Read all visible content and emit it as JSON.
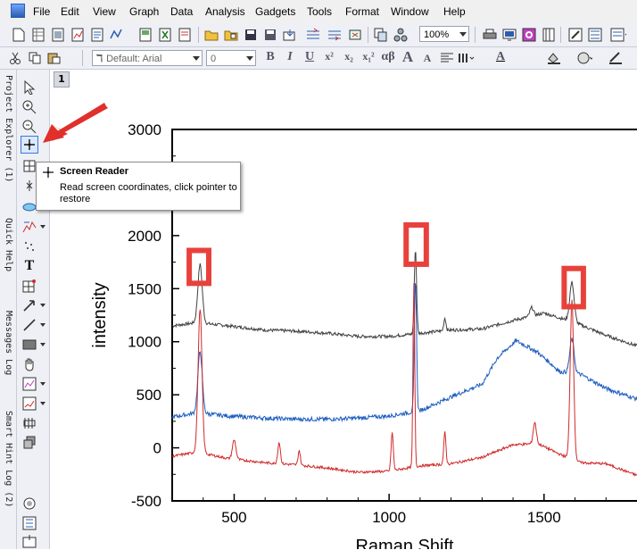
{
  "menu": [
    "File",
    "Edit",
    "View",
    "Graph",
    "Data",
    "Analysis",
    "Gadgets",
    "Tools",
    "Format",
    "Window",
    "Help"
  ],
  "toolbar": {
    "zoom_value": "100%",
    "font_name": "Default: Arial",
    "font_size": "0",
    "bold": "B",
    "italic": "I",
    "underline": "U",
    "superscript": "x²",
    "subscript": "x₂",
    "supsub": "x₁²",
    "greek": "αβ",
    "grow_font": "A",
    "shrink_font": "A",
    "font_color": "A"
  },
  "left_panels": [
    "Project Explorer (1)",
    "Quick Help",
    "Messages Log",
    "Smart Hint Log (2)"
  ],
  "graph": {
    "layer_label": "1"
  },
  "tooltip": {
    "title": "Screen Reader",
    "body": "Read screen coordinates, click pointer to restore"
  },
  "colors": {
    "black_series": "#404040",
    "blue_series": "#1f5fbf",
    "red_series": "#d02b2b",
    "highlight": "#e8413c"
  },
  "chart_data": {
    "type": "line",
    "xlabel": "Raman Shift",
    "ylabel": "intensity",
    "xlim": [
      300,
      1800
    ],
    "ylim": [
      -500,
      3000
    ],
    "x_ticks": [
      500,
      1000,
      1500
    ],
    "y_ticks": [
      -500,
      0,
      500,
      1000,
      1500,
      2000,
      2500,
      3000
    ],
    "series": [
      {
        "color": "#404040",
        "baseline": [
          [
            300,
            1150
          ],
          [
            380,
            1180
          ],
          [
            480,
            1150
          ],
          [
            600,
            1110
          ],
          [
            700,
            1100
          ],
          [
            800,
            1080
          ],
          [
            900,
            1050
          ],
          [
            1000,
            1050
          ],
          [
            1100,
            1080
          ],
          [
            1200,
            1110
          ],
          [
            1300,
            1120
          ],
          [
            1400,
            1200
          ],
          [
            1500,
            1270
          ],
          [
            1600,
            1180
          ],
          [
            1700,
            1060
          ],
          [
            1800,
            960
          ]
        ],
        "peaks": [
          [
            390,
            550,
            10
          ],
          [
            1085,
            800,
            5
          ],
          [
            1180,
            120,
            5
          ],
          [
            1460,
            80,
            8
          ],
          [
            1590,
            370,
            10
          ]
        ],
        "noise": 15
      },
      {
        "color": "#1f5fbf",
        "baseline": [
          [
            300,
            290
          ],
          [
            380,
            330
          ],
          [
            480,
            300
          ],
          [
            600,
            280
          ],
          [
            700,
            270
          ],
          [
            800,
            270
          ],
          [
            900,
            280
          ],
          [
            1000,
            300
          ],
          [
            1100,
            350
          ],
          [
            1200,
            480
          ],
          [
            1300,
            600
          ],
          [
            1350,
            850
          ],
          [
            1410,
            1010
          ],
          [
            1480,
            900
          ],
          [
            1550,
            720
          ],
          [
            1620,
            690
          ],
          [
            1700,
            560
          ],
          [
            1800,
            460
          ]
        ],
        "peaks": [
          [
            390,
            580,
            10
          ],
          [
            1085,
            1250,
            5
          ],
          [
            1590,
            320,
            10
          ]
        ],
        "noise": 20
      },
      {
        "color": "#d02b2b",
        "baseline": [
          [
            300,
            -80
          ],
          [
            380,
            -40
          ],
          [
            480,
            -100
          ],
          [
            600,
            -140
          ],
          [
            700,
            -160
          ],
          [
            800,
            -190
          ],
          [
            900,
            -230
          ],
          [
            1000,
            -220
          ],
          [
            1100,
            -170
          ],
          [
            1200,
            -150
          ],
          [
            1300,
            -90
          ],
          [
            1400,
            30
          ],
          [
            1480,
            40
          ],
          [
            1550,
            -60
          ],
          [
            1620,
            -140
          ],
          [
            1700,
            -150
          ],
          [
            1800,
            -260
          ]
        ],
        "peaks": [
          [
            390,
            1360,
            9
          ],
          [
            500,
            180,
            8
          ],
          [
            645,
            200,
            6
          ],
          [
            710,
            140,
            5
          ],
          [
            1010,
            360,
            5
          ],
          [
            1080,
            1730,
            4
          ],
          [
            1180,
            300,
            5
          ],
          [
            1470,
            200,
            7
          ],
          [
            1590,
            1500,
            8
          ]
        ],
        "noise": 12
      }
    ],
    "highlight_boxes": [
      {
        "x": [
          355,
          418
        ],
        "y": [
          1550,
          1860
        ]
      },
      {
        "x": [
          1055,
          1120
        ],
        "y": [
          1730,
          2100
        ]
      },
      {
        "x": [
          1565,
          1627
        ],
        "y": [
          1330,
          1690
        ]
      }
    ]
  }
}
